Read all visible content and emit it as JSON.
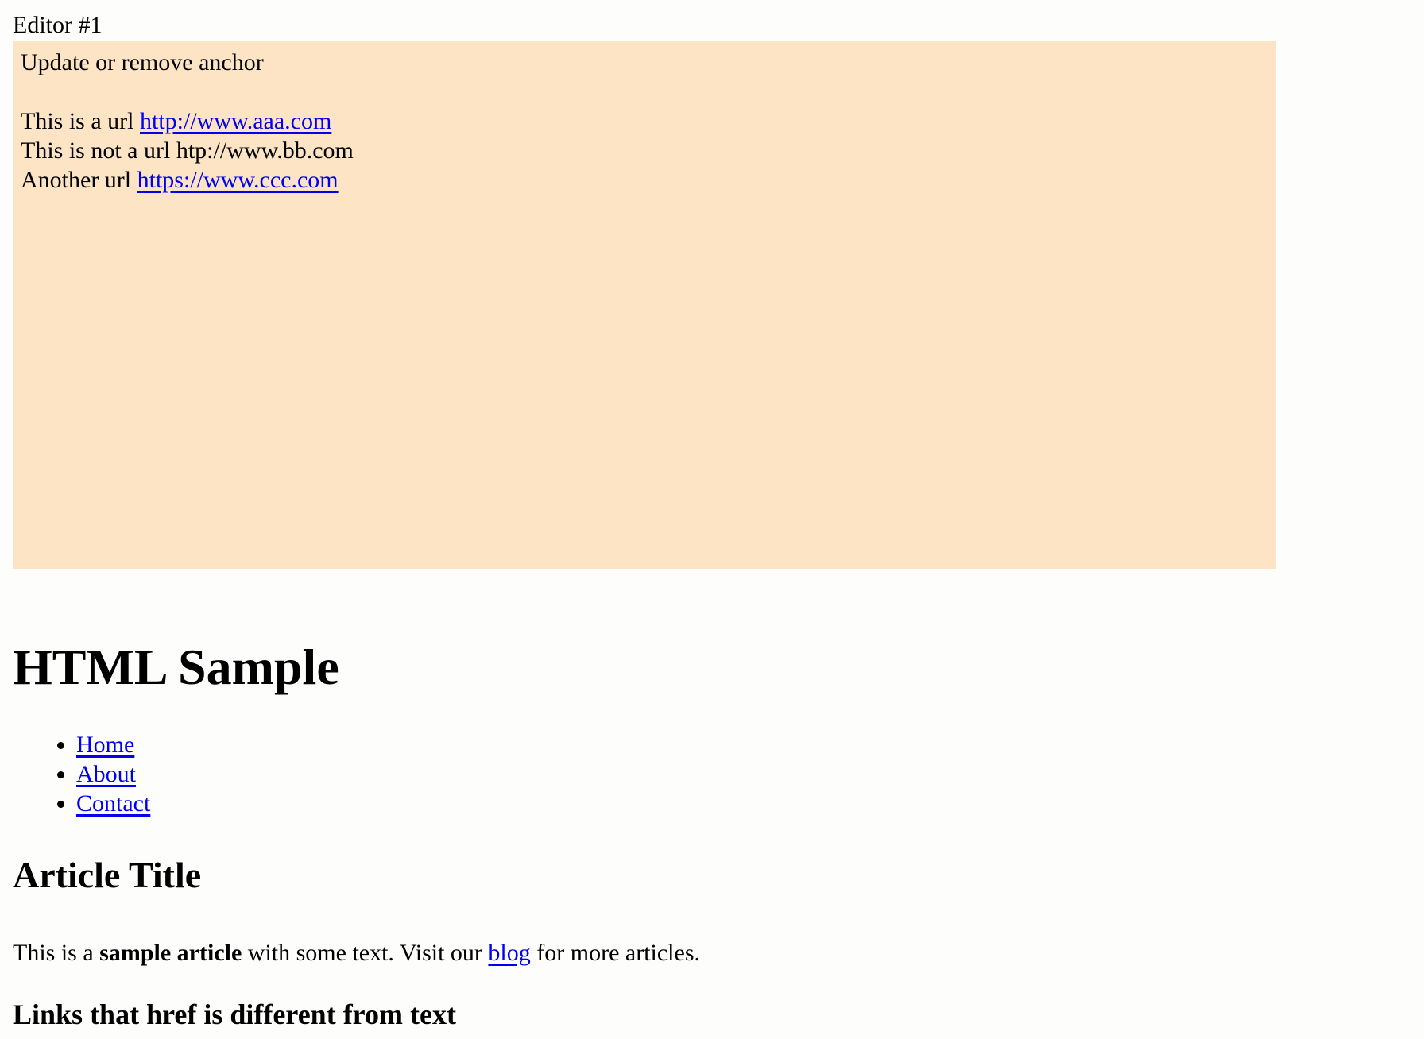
{
  "editor": {
    "label": "Editor #1",
    "heading": "Update or remove anchor",
    "line1_prefix": "This is a url ",
    "line1_link": "http://www.aaa.com",
    "line2": "This is not a url htp://www.bb.com",
    "line3_prefix": "Another url ",
    "line3_link": "https://www.ccc.com",
    "background_color": "#fde4c5"
  },
  "page": {
    "title": "HTML Sample",
    "nav": [
      {
        "label": "Home"
      },
      {
        "label": "About"
      },
      {
        "label": "Contact"
      }
    ],
    "article": {
      "title": "Article Title",
      "text_before": "This is a ",
      "bold_text": "sample article",
      "text_middle": " with some text. Visit our ",
      "link_text": "blog",
      "text_after": " for more articles."
    },
    "subheading": "Links that href is different from text"
  },
  "colors": {
    "link": "#0000ee",
    "text": "#000000",
    "page_background": "#fdfdfc"
  }
}
